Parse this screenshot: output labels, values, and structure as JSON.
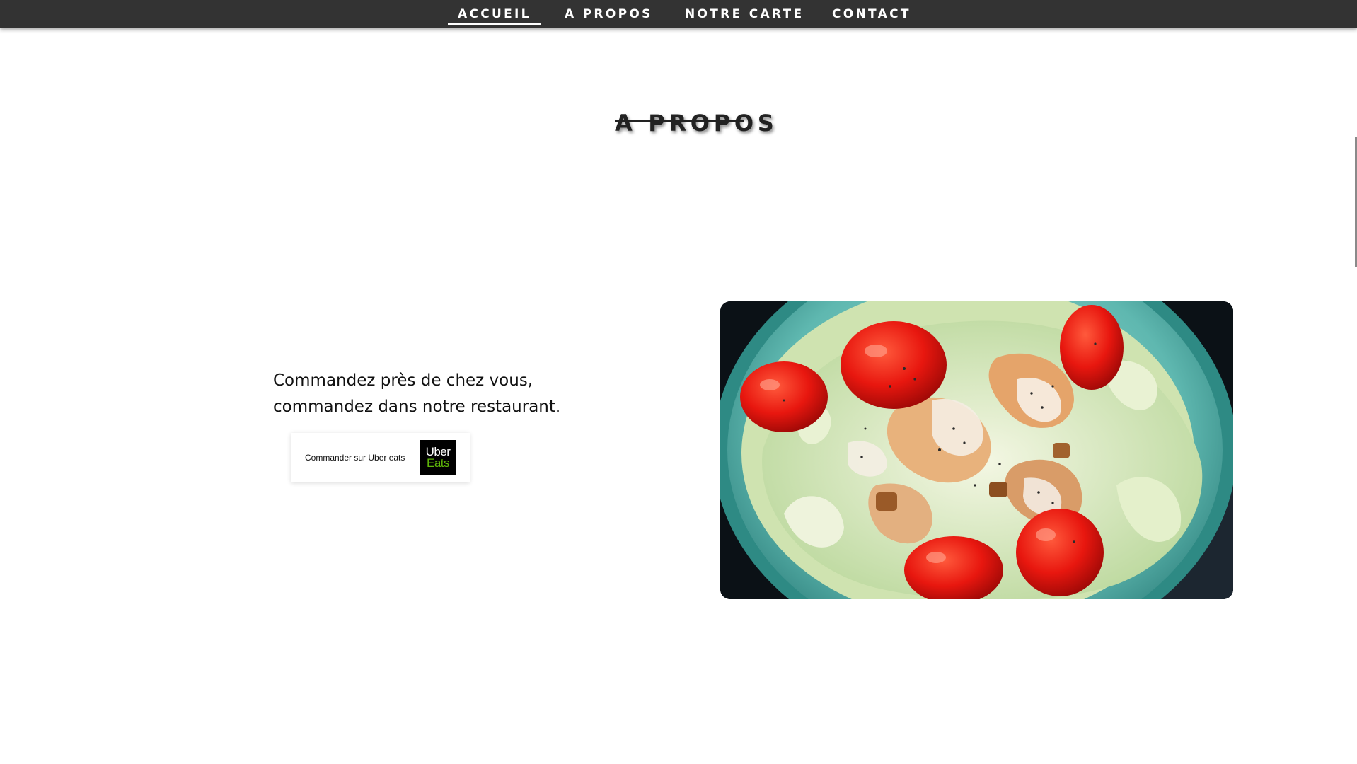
{
  "nav": {
    "items": [
      {
        "label": "ACCUEIL"
      },
      {
        "label": "A PROPOS"
      },
      {
        "label": "NOTRE CARTE"
      },
      {
        "label": "CONTACT"
      }
    ]
  },
  "about": {
    "title": "A PROPOS"
  },
  "promo": {
    "line1": "Commandez près de chez vous,",
    "line2": "commandez dans notre restaurant."
  },
  "order_button": {
    "label": "Commander sur Uber eats",
    "logo_line1": "Uber",
    "logo_line2": "Eats",
    "logo_accent": "#5fb709"
  },
  "image": {
    "alt": "Salade avec tomates cerises, poulet et sauce"
  },
  "colors": {
    "navbar_bg": "#333333",
    "nav_text": "#ffffff",
    "title_text": "#222222"
  }
}
